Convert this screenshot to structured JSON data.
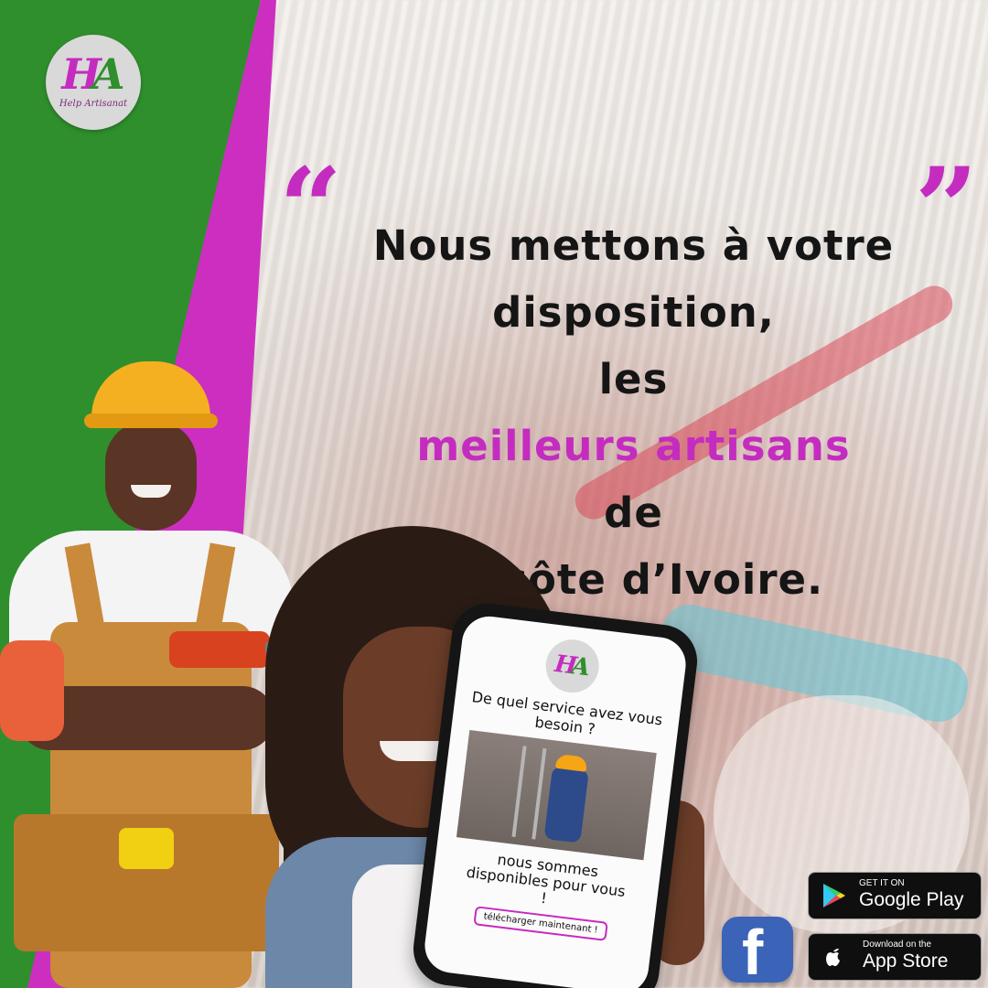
{
  "logo": {
    "mark_h": "H",
    "mark_a": "A",
    "text": "Help Artisanat"
  },
  "quote": {
    "open_mark": "“",
    "close_mark": "”",
    "line1": "Nous mettons à votre",
    "line2": "disposition,",
    "line3_pre": "les ",
    "line3_highlight": "meilleurs artisans",
    "line3_post": " de",
    "line4": "la côte d’Ivoire."
  },
  "phone": {
    "logo_h": "H",
    "logo_a": "A",
    "question": "De quel service avez vous besoin ?",
    "availability": "nous sommes disponibles pour vous !",
    "download_button": "télécharger maintenant !"
  },
  "stores": {
    "google_small": "GET IT ON",
    "google_big": "Google Play",
    "apple_small": "Download on the",
    "apple_big": "App Store"
  },
  "social": {
    "facebook_glyph": "f"
  },
  "colors": {
    "green": "#2f8f2d",
    "magenta": "#cc2fc0",
    "text_dark": "#151515"
  },
  "icons": [
    "google-play-icon",
    "apple-icon",
    "facebook-icon",
    "quote-open-icon",
    "quote-close-icon"
  ]
}
